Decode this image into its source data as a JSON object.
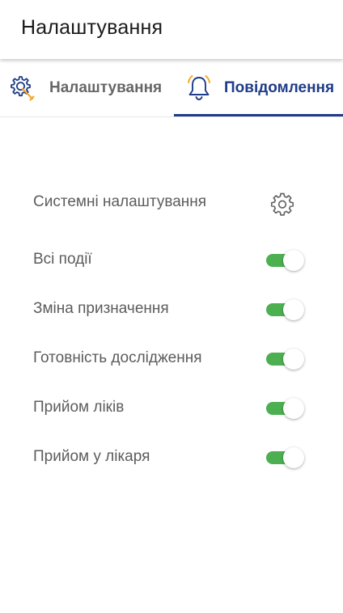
{
  "appbar": {
    "title": "Налаштування"
  },
  "tabs": [
    {
      "label": "Налаштування",
      "icon": "gear-wrench-icon",
      "active": false
    },
    {
      "label": "Повідомлення",
      "icon": "bell-icon",
      "active": true
    }
  ],
  "settings": {
    "system_label": "Системні налаштування",
    "system_icon": "gear-icon",
    "toggles": [
      {
        "label": "Всі події",
        "on": true
      },
      {
        "label": "Зміна призначення",
        "on": true
      },
      {
        "label": "Готовність дослідження",
        "on": true
      },
      {
        "label": "Прийом ліків",
        "on": true
      },
      {
        "label": "Прийом у лікаря",
        "on": true
      }
    ]
  },
  "colors": {
    "accent": "#1f3c88",
    "icon_orange": "#f5a623",
    "toggle_on": "#4caf50",
    "text_secondary": "#5c5c5c"
  }
}
